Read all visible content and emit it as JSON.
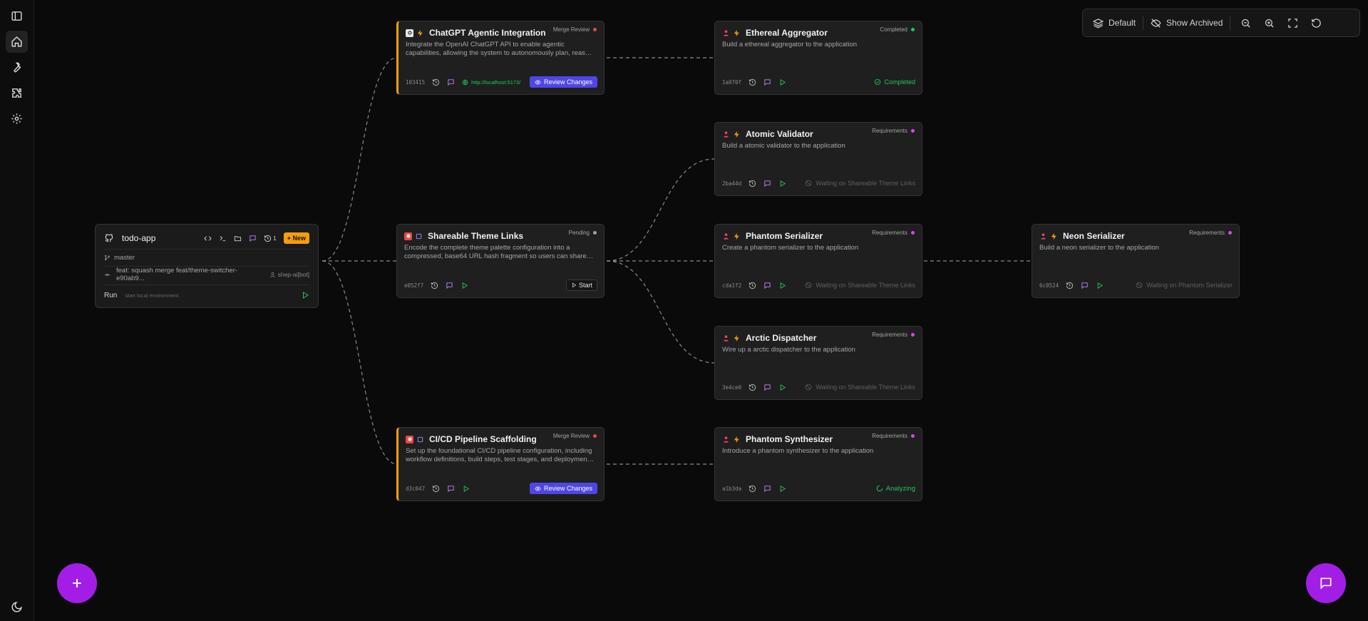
{
  "colors": {
    "accent_purple": "#a21ee6",
    "accent_orange": "#f59e0b",
    "review_blue": "#4f46e5",
    "success_green": "#22c55e",
    "status_red": "#ef4444",
    "status_magenta": "#d946ef",
    "status_gray": "#9ca3af"
  },
  "sidebar": {
    "items": [
      {
        "icon": "sidebar-toggle-icon"
      },
      {
        "icon": "home-icon"
      },
      {
        "icon": "wrench-icon"
      },
      {
        "icon": "puzzle-icon"
      },
      {
        "icon": "gear-icon"
      }
    ],
    "theme_icon": "moon-icon"
  },
  "toolbar": {
    "layout_label": "Default",
    "archived_label": "Show Archived",
    "icons": [
      "zoom-out-icon",
      "zoom-in-icon",
      "fit-view-icon",
      "reset-icon"
    ]
  },
  "repo": {
    "name": "todo-app",
    "history_count": "1",
    "new_label": "+ New",
    "branch": "master",
    "commit": "feat: squash merge feat/theme-switcher-e90ab9...",
    "author": "shep-ai[bot]",
    "run_label": "Run",
    "run_hint": "start local environment"
  },
  "cards": {
    "chatgpt": {
      "title": "ChatGPT Agentic Integration",
      "status": "Merge Review",
      "desc": "Integrate the OpenAI ChatGPT API to enable agentic capabilities, allowing the system to autonomously plan, reason, and execute multi-step tasks.",
      "hash": "103415",
      "url": "http://localhost:5173/",
      "action": "Review Changes"
    },
    "theme": {
      "title": "Shareable Theme Links",
      "status": "Pending",
      "desc": "Encode the complete theme palette configuration into a compressed, base64 URL hash fragment so users can share exact themes with others.",
      "hash": "e052f7",
      "action": "Start"
    },
    "cicd": {
      "title": "CI/CD Pipeline Scaffolding",
      "status": "Merge Review",
      "desc": "Set up the foundational CI/CD pipeline configuration, including workflow definitions, build steps, test stages, and deployment targets.",
      "hash": "d3c047",
      "action": "Review Changes"
    },
    "ethereal": {
      "title": "Ethereal Aggregator",
      "status": "Completed",
      "desc": "Build a ethereal aggregator to the application",
      "hash": "1a070f",
      "state": "Completed"
    },
    "atomic": {
      "title": "Atomic Validator",
      "status": "Requirements",
      "desc": "Build a atomic validator to the application",
      "hash": "2ba44d",
      "state": "Waiting on Shareable Theme Links"
    },
    "phantom_ser": {
      "title": "Phantom Serializer",
      "status": "Requirements",
      "desc": "Create a phantom serializer to the application",
      "hash": "cda1f2",
      "state": "Waiting on Shareable Theme Links"
    },
    "arctic": {
      "title": "Arctic Dispatcher",
      "status": "Requirements",
      "desc": "Wire up a arctic dispatcher to the application",
      "hash": "3e4ce0",
      "state": "Waiting on Shareable Theme Links"
    },
    "phantom_syn": {
      "title": "Phantom Synthesizer",
      "status": "Requirements",
      "desc": "Introduce a phantom synthesizer to the application",
      "hash": "a1b3da",
      "state": "Analyzing"
    },
    "neon": {
      "title": "Neon Serializer",
      "status": "Requirements",
      "desc": "Build a neon serializer to the application",
      "hash": "6c0524",
      "state": "Waiting on Phantom Serializer"
    }
  }
}
